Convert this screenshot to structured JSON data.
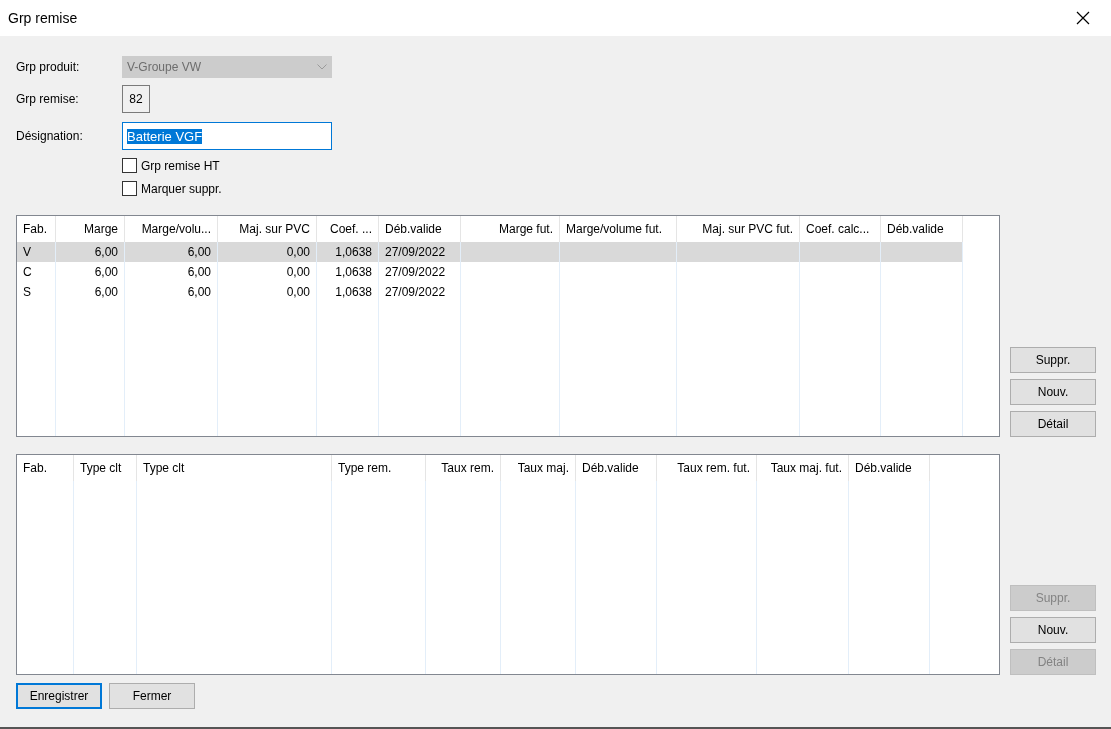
{
  "window": {
    "title": "Grp remise"
  },
  "form": {
    "product_group": {
      "label": "Grp produit:",
      "value": "V-Groupe VW",
      "disabled": true
    },
    "discount_group": {
      "label": "Grp remise:",
      "value": "82"
    },
    "designation": {
      "label": "Désignation:",
      "value": "Batterie VGF",
      "text_selected": true
    },
    "checkboxes": [
      {
        "label": "Grp remise HT",
        "checked": false
      },
      {
        "label": "Marquer suppr.",
        "checked": false
      }
    ]
  },
  "margin_table": {
    "columns": [
      {
        "label": "Fab.",
        "kind": "text"
      },
      {
        "label": "Marge",
        "kind": "number"
      },
      {
        "label": "Marge/volu...",
        "kind": "number"
      },
      {
        "label": "Maj. sur PVC",
        "kind": "number"
      },
      {
        "label": "Coef. ...",
        "kind": "number"
      },
      {
        "label": "Déb.valide",
        "kind": "text"
      },
      {
        "label": "Marge fut.",
        "kind": "number"
      },
      {
        "label": "Marge/volume fut.",
        "kind": "text"
      },
      {
        "label": "Maj. sur PVC fut.",
        "kind": "number"
      },
      {
        "label": "Coef. calc...",
        "kind": "text"
      },
      {
        "label": "Déb.valide",
        "kind": "text"
      }
    ],
    "rows": [
      {
        "cells": [
          "V",
          "6,00",
          "6,00",
          "0,00",
          "1,0638",
          "27/09/2022"
        ],
        "selected": true
      },
      {
        "cells": [
          "C",
          "6,00",
          "6,00",
          "0,00",
          "1,0638",
          "27/09/2022"
        ],
        "selected": false
      },
      {
        "cells": [
          "S",
          "6,00",
          "6,00",
          "0,00",
          "1,0638",
          "27/09/2022"
        ],
        "selected": false
      }
    ],
    "buttons": [
      {
        "label": "Suppr.",
        "disabled": false
      },
      {
        "label": "Nouv.",
        "disabled": false
      },
      {
        "label": "Détail",
        "disabled": false
      }
    ]
  },
  "discount_table": {
    "columns": [
      {
        "label": "Fab.",
        "kind": "text"
      },
      {
        "label": "Type clt",
        "kind": "text"
      },
      {
        "label": "Type clt",
        "kind": "text"
      },
      {
        "label": "Type rem.",
        "kind": "text"
      },
      {
        "label": "Taux rem.",
        "kind": "number"
      },
      {
        "label": "Taux maj.",
        "kind": "number"
      },
      {
        "label": "Déb.valide",
        "kind": "text"
      },
      {
        "label": "Taux rem. fut.",
        "kind": "number"
      },
      {
        "label": "Taux maj. fut.",
        "kind": "number"
      },
      {
        "label": "Déb.valide",
        "kind": "text"
      }
    ],
    "buttons": [
      {
        "label": "Suppr.",
        "disabled": true
      },
      {
        "label": "Nouv.",
        "disabled": false
      },
      {
        "label": "Détail",
        "disabled": true
      }
    ]
  },
  "footer_buttons": [
    {
      "label": "Enregistrer",
      "default": true
    },
    {
      "label": "Fermer",
      "default": false
    }
  ]
}
